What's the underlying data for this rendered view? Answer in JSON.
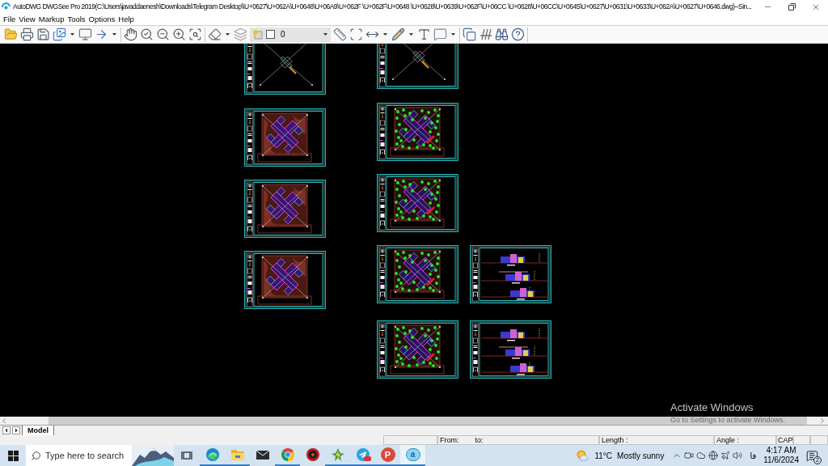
{
  "window": {
    "title": "AutoDWG DWGSee Pro 2019(C:\\Users\\javaddaenesh\\Downloads\\Telegram Desktop\\\\U+0627\\U+062A\\U+0648\\U+06A9\\U+062F \\U+062F\\U+0648 \\U+0628\\U+0639\\U+062F\\U+06CC \\U+0628\\U+06CC\\U+0645\\U+0627\\U+0631\\U+0633\\U+062A\\U+0627\\U+0646.dwg)--Sin..."
  },
  "menu": [
    "File",
    "View",
    "Markup",
    "Tools",
    "Options",
    "Help"
  ],
  "toolbar": {
    "layer_dropdown": {
      "value": "0",
      "checked": false
    }
  },
  "canvas": {
    "columns": [
      {
        "sheets": [
          {
            "kind": "site-plan"
          },
          {
            "kind": "hatched-plan"
          },
          {
            "kind": "hatched-plan"
          },
          {
            "kind": "hatched-plan"
          }
        ]
      },
      {
        "sheets": [
          {
            "kind": "site-plan"
          },
          {
            "kind": "landscape-plan"
          },
          {
            "kind": "landscape-plan"
          },
          {
            "kind": "landscape-plan"
          },
          {
            "kind": "landscape-plan"
          }
        ]
      },
      {
        "sheets": [
          {
            "kind": "elevations"
          },
          {
            "kind": "elevations"
          }
        ]
      }
    ]
  },
  "activation_notice": {
    "title": "Activate Windows",
    "subtitle": "Go to Settings to activate Windows."
  },
  "tabs": [
    {
      "label": "Model",
      "selected": true
    }
  ],
  "status_bar": {
    "from_label": "From:",
    "to_label": "to:",
    "length_label": "Length :",
    "angle_label": "Angle :",
    "caps_indicator": "CAP"
  },
  "taskbar": {
    "search": {
      "placeholder": "Type here to search"
    },
    "apps": [
      {
        "kind": "wave-browser",
        "running": true,
        "selected": false,
        "badge": false
      },
      {
        "kind": "folder",
        "running": true,
        "selected": false,
        "badge": false
      },
      {
        "kind": "mail",
        "running": false,
        "selected": false,
        "badge": false
      },
      {
        "kind": "round-browser",
        "running": true,
        "selected": false,
        "badge": false
      },
      {
        "kind": "disc",
        "running": false,
        "selected": false,
        "badge": false
      },
      {
        "kind": "lightning",
        "running": true,
        "selected": false,
        "badge": false
      },
      {
        "kind": "messenger",
        "running": true,
        "selected": false,
        "badge": true
      },
      {
        "kind": "letter",
        "glyph": "P",
        "running": true,
        "selected": false,
        "badge": false
      },
      {
        "kind": "letter-bubble",
        "glyph": "a",
        "running": true,
        "selected": true,
        "badge": false
      }
    ],
    "weather": {
      "temperature": "11°C",
      "condition": "Mostly sunny"
    },
    "language": "فا",
    "time": "4:17 AM",
    "date": "11/6/2024",
    "notification_count": "2"
  }
}
